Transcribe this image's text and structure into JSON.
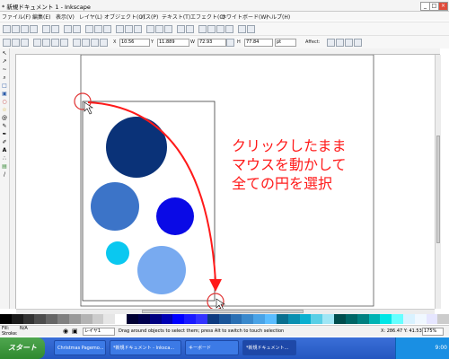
{
  "window": {
    "title": "* 新規ドキュメント 1 - Inkscape",
    "buttons": [
      "_",
      "□",
      "×"
    ]
  },
  "menubar": {
    "items": [
      "ファイル(F)",
      "編集(E)",
      "表示(V)",
      "レイヤ(L)",
      "オブジェクト(O)",
      "パス(P)",
      "テキスト(T)",
      "エフェクト(C)",
      "ホワイトボード(W)",
      "ヘルプ(H)"
    ]
  },
  "tool_controls": {
    "x_label": "X",
    "x_value": "10.56",
    "y_label": "Y",
    "y_value": "11.889",
    "w_label": "W",
    "w_value": "72.93",
    "h_label": "H",
    "h_value": "77.84",
    "unit": "pt",
    "affect_label": "Affect:"
  },
  "annotation": {
    "lines": [
      "クリックしたまま",
      "マウスを動かして",
      "全ての円を選択"
    ],
    "color": "#ff1a1a"
  },
  "circles": [
    {
      "name": "circle-navy",
      "color": "#0a3278"
    },
    {
      "name": "circle-medium-blue",
      "color": "#3c74c8"
    },
    {
      "name": "circle-bright-blue",
      "color": "#0a0ae6"
    },
    {
      "name": "circle-cyan",
      "color": "#0ac8f0"
    },
    {
      "name": "circle-light-blue",
      "color": "#78aaf0"
    }
  ],
  "palette": {
    "colors": [
      "#000000",
      "#1a1a1a",
      "#333333",
      "#4d4d4d",
      "#666666",
      "#808080",
      "#999999",
      "#b3b3b3",
      "#cccccc",
      "#e6e6e6",
      "#ffffff",
      "#000033",
      "#00004d",
      "#000080",
      "#0000b3",
      "#0000ff",
      "#1a1aff",
      "#3333ff",
      "#0d3a80",
      "#1a5599",
      "#2a6fb3",
      "#3a89cc",
      "#4aa3e6",
      "#5bbdff",
      "#0a6f8f",
      "#0a8fb0",
      "#0ab0d0",
      "#5acfe6",
      "#a0e6f5",
      "#004d4d",
      "#006666",
      "#008080",
      "#00b3b3",
      "#00e6e6",
      "#66ffff",
      "#d9f2ff",
      "#f0f8ff",
      "#e6e6ff",
      "#cccccc"
    ]
  },
  "statusbar": {
    "style_label": "Fill:",
    "style_value": "N/A",
    "stroke_label": "Stroke:",
    "layer_value": "レイヤ1",
    "message": "Drag around objects to select them; press Alt to switch to touch selection",
    "cursor": "X: 286.47  Y: 41.53",
    "zoom": "175%"
  },
  "taskbar": {
    "start_label": "スタート",
    "tasks": [
      "Christmas Pagemo...",
      "*新規ドキュメント - Inksca...",
      "キーボード",
      "*新規ドキュメント..."
    ],
    "clock": "9:00"
  }
}
